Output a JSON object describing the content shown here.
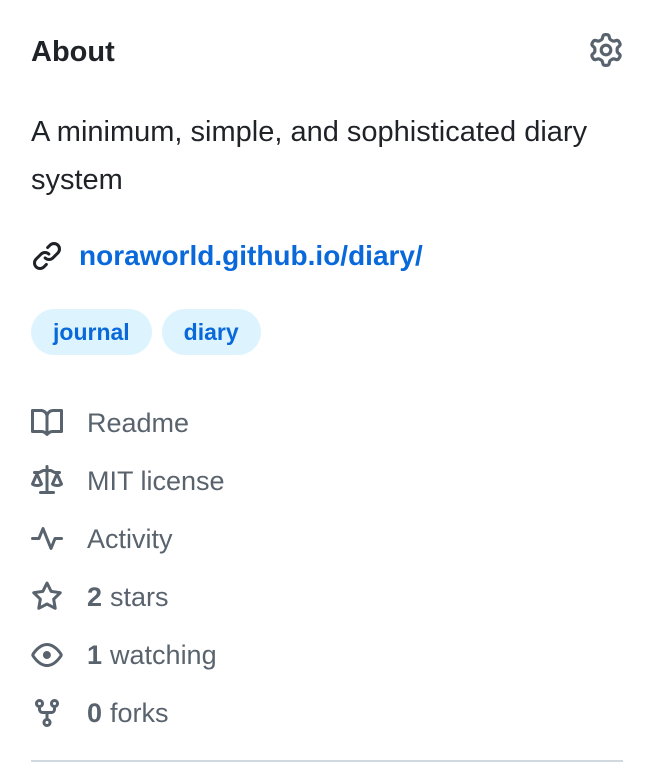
{
  "about": {
    "title": "About",
    "description": "A minimum, simple, and sophisticated diary system",
    "homepage": "noraworld.github.io/diary/",
    "topics": [
      {
        "label": "journal"
      },
      {
        "label": "diary"
      }
    ],
    "meta": {
      "readme": "Readme",
      "license": "MIT license",
      "activity": "Activity",
      "stars_count": "2",
      "stars_label": "stars",
      "watching_count": "1",
      "watching_label": "watching",
      "forks_count": "0",
      "forks_label": "forks"
    }
  },
  "colors": {
    "link": "#0969da",
    "topic_bg": "#ddf4ff",
    "muted": "#59636e",
    "text": "#1f2328"
  },
  "icons": [
    "gear-icon",
    "link-icon",
    "book-icon",
    "law-icon",
    "pulse-icon",
    "star-icon",
    "eye-icon",
    "repo-forked-icon"
  ]
}
